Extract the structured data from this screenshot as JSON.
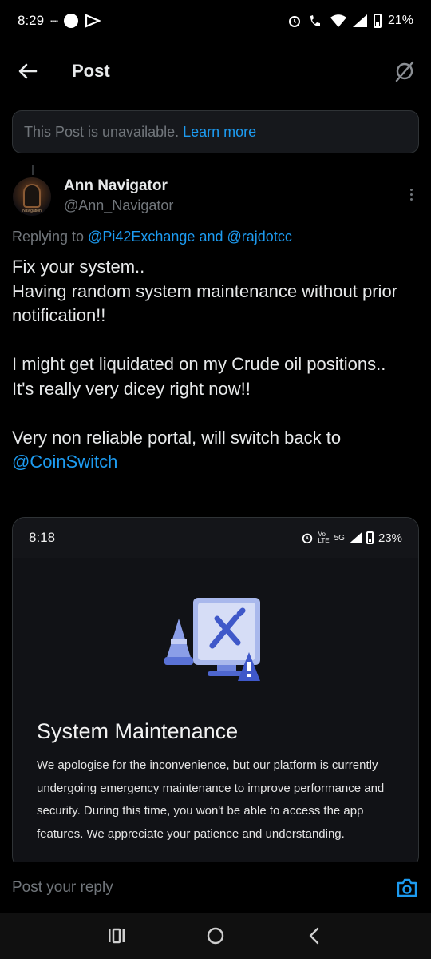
{
  "status_bar": {
    "time": "8:29",
    "tiny_text": "▪▪▪▪",
    "battery": "21%"
  },
  "header": {
    "title": "Post"
  },
  "notice": {
    "text": "This Post is unavailable.",
    "link": "Learn more"
  },
  "post": {
    "author_name": "Ann Navigator",
    "author_handle": "@Ann_Navigator",
    "avatar_caption": "Navigation",
    "replying_prefix": "Replying to",
    "replying_mention_1": "@Pi42Exchange",
    "replying_and": "and",
    "replying_mention_2": "@rajdotcc",
    "lines": [
      "Fix your system..",
      "Having random system maintenance without prior notification!!",
      "",
      "I might get liquidated on my Crude oil positions..",
      "It's really very dicey right now!!",
      "",
      "Very non reliable portal, will switch back to"
    ],
    "final_mention": "@CoinSwitch"
  },
  "media": {
    "time": "8:18",
    "net_top": "Vo",
    "net_bottom": "LTE",
    "network": "5G",
    "battery": "23%",
    "title": "System Maintenance",
    "body": "We apologise for the inconvenience, but our platform is currently undergoing emergency maintenance to improve performance and security. During this time, you won't be able to access the app features. We appreciate your patience and understanding."
  },
  "reply": {
    "placeholder": "Post your reply"
  },
  "icons": {
    "back": "arrow-left-icon",
    "grok": "slashed-circle-icon",
    "more": "more-vertical-icon",
    "camera": "camera-icon",
    "recents": "recents-icon",
    "home": "home-circle-icon",
    "nav_back": "chevron-left-icon"
  },
  "colors": {
    "accent": "#1d9bf0",
    "muted": "#71767b",
    "text": "#e7e9ea",
    "background": "#000000"
  }
}
